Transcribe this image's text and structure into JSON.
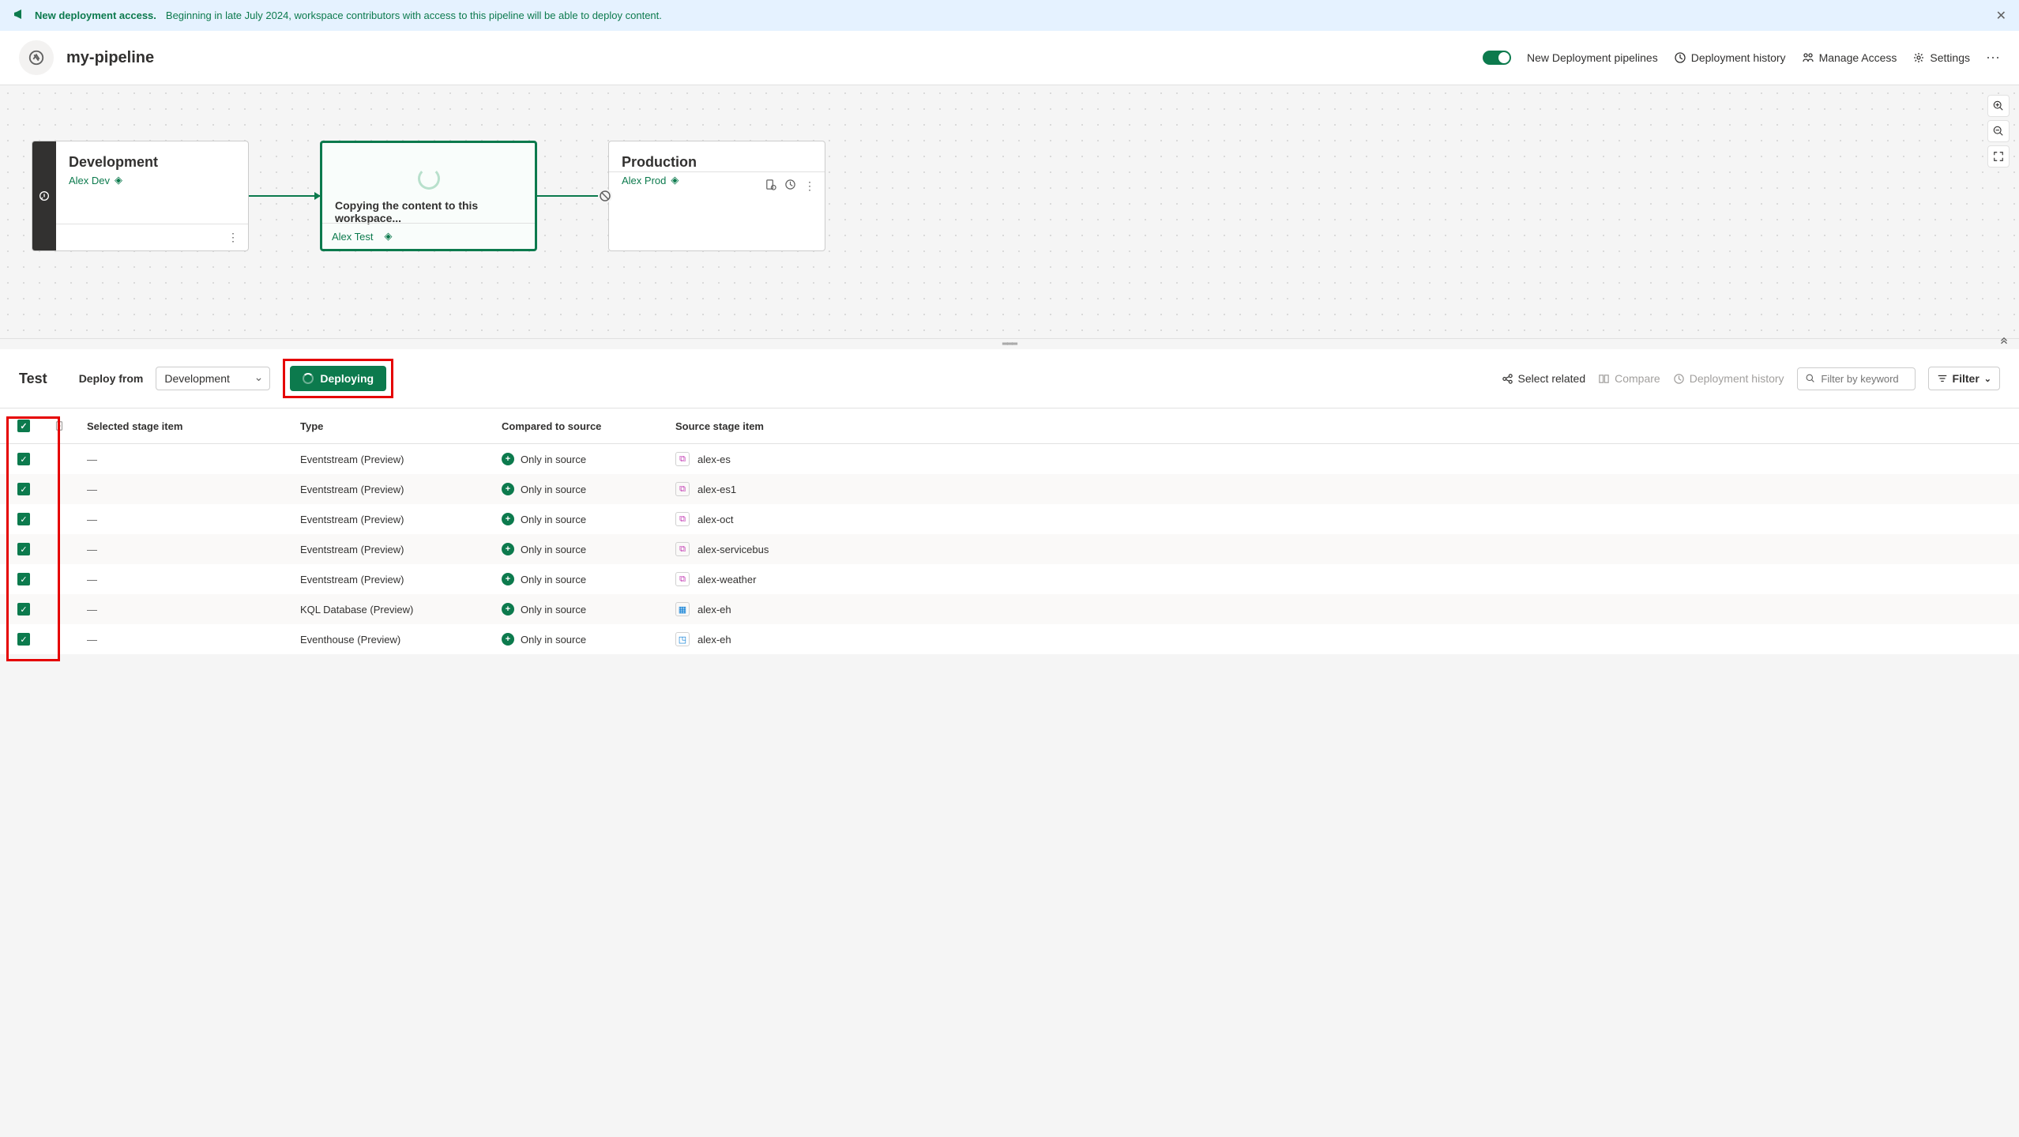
{
  "banner": {
    "title": "New deployment access.",
    "text": "Beginning in late July 2024, workspace contributors with access to this pipeline will be able to deploy content."
  },
  "header": {
    "title": "my-pipeline",
    "newPipelines": "New Deployment pipelines",
    "history": "Deployment history",
    "manageAccess": "Manage Access",
    "settings": "Settings"
  },
  "stages": {
    "dev": {
      "title": "Development",
      "subtitle": "Alex Dev"
    },
    "test": {
      "copying": "Copying the content to this workspace...",
      "footer": "Alex Test"
    },
    "prod": {
      "title": "Production",
      "subtitle": "Alex Prod"
    }
  },
  "toolbar": {
    "title": "Test",
    "deployFromLabel": "Deploy from",
    "deployFromValue": "Development",
    "deployingBtn": "Deploying",
    "selectRelated": "Select related",
    "compare": "Compare",
    "deployHistory": "Deployment history",
    "searchPlaceholder": "Filter by keyword",
    "filterBtn": "Filter"
  },
  "table": {
    "headers": {
      "selected": "Selected stage item",
      "type": "Type",
      "compared": "Compared to source",
      "source": "Source stage item"
    },
    "rows": [
      {
        "selected": "—",
        "type": "Eventstream (Preview)",
        "compared": "Only in source",
        "source": "alex-es",
        "iconClass": "pink",
        "iconChar": "⧉"
      },
      {
        "selected": "—",
        "type": "Eventstream (Preview)",
        "compared": "Only in source",
        "source": "alex-es1",
        "iconClass": "pink",
        "iconChar": "⧉"
      },
      {
        "selected": "—",
        "type": "Eventstream (Preview)",
        "compared": "Only in source",
        "source": "alex-oct",
        "iconClass": "pink",
        "iconChar": "⧉"
      },
      {
        "selected": "—",
        "type": "Eventstream (Preview)",
        "compared": "Only in source",
        "source": "alex-servicebus",
        "iconClass": "pink",
        "iconChar": "⧉"
      },
      {
        "selected": "—",
        "type": "Eventstream (Preview)",
        "compared": "Only in source",
        "source": "alex-weather",
        "iconClass": "pink",
        "iconChar": "⧉"
      },
      {
        "selected": "—",
        "type": "KQL Database (Preview)",
        "compared": "Only in source",
        "source": "alex-eh",
        "iconClass": "blue",
        "iconChar": "▦"
      },
      {
        "selected": "—",
        "type": "Eventhouse (Preview)",
        "compared": "Only in source",
        "source": "alex-eh",
        "iconClass": "blue",
        "iconChar": "◳"
      }
    ]
  }
}
